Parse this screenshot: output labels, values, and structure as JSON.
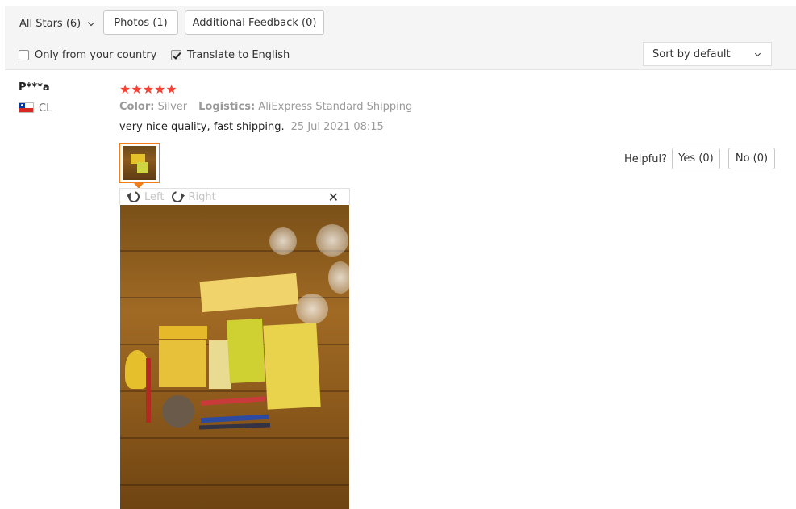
{
  "filters": {
    "all_stars": "All Stars (6)",
    "photos": "Photos (1)",
    "additional_feedback": "Additional Feedback (0)",
    "only_country": "Only from your country",
    "only_country_checked": false,
    "translate": "Translate to English",
    "translate_checked": true,
    "sort": "Sort by default"
  },
  "review": {
    "name": "P***a",
    "country": "CL",
    "rating": 5,
    "stars": "★★★★★",
    "color_label": "Color:",
    "color_value": "Silver",
    "logistics_label": "Logistics:",
    "logistics_value": "AliExpress Standard Shipping",
    "text": "very nice quality, fast shipping.",
    "date": "25 Jul 2021 08:15"
  },
  "viewer": {
    "rotate_left": "Left",
    "rotate_right": "Right",
    "close": "✕"
  },
  "helpful": {
    "label": "Helpful?",
    "yes": "Yes (0)",
    "no": "No (0)"
  },
  "colors": {
    "star": "#f44336",
    "thumb_border": "#f07c1a"
  }
}
